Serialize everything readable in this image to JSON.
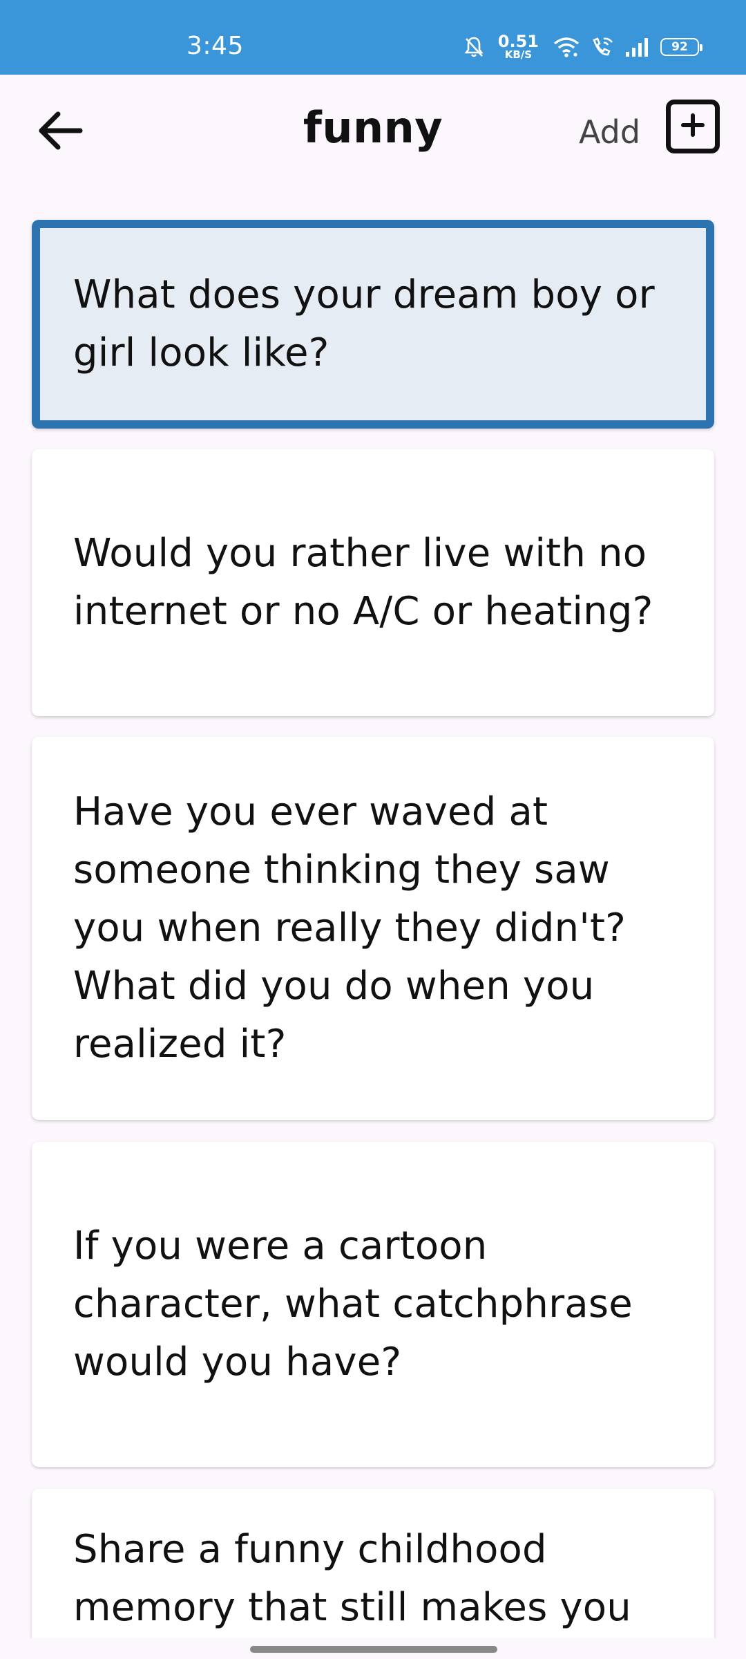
{
  "status_bar": {
    "time": "3:45",
    "net_speed_value": "0.51",
    "net_speed_unit": "KB/S",
    "battery_level": "92",
    "background_color": "#3b96d9"
  },
  "header": {
    "title": "funny",
    "add_label": "Add",
    "back_icon": "arrow-left-icon",
    "add_icon": "plus-square-icon"
  },
  "questions": [
    {
      "text": "What does your dream boy or girl look like?",
      "selected": true
    },
    {
      "text": "Would you rather live with no internet or no A/C or heating?",
      "selected": false
    },
    {
      "text": "Have you ever waved at someone thinking they saw you when really they didn't? What did you do when you realized it?",
      "selected": false
    },
    {
      "text": "If you were a cartoon character, what catchphrase would you have?",
      "selected": false
    },
    {
      "text": "Share a funny childhood memory that still makes you",
      "selected": false
    }
  ],
  "colors": {
    "selected_border": "#2c73b0",
    "selected_background": "#e6ecf3",
    "page_background": "#fcf7fc"
  }
}
